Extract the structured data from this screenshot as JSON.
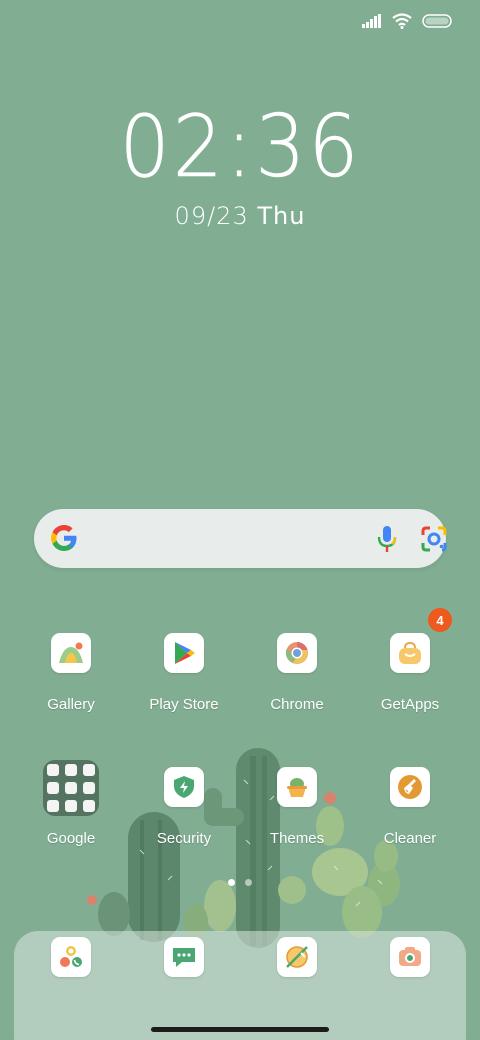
{
  "status_bar": {
    "signal_icon": "signal-icon",
    "wifi_icon": "wifi-icon",
    "battery_icon": "battery-icon"
  },
  "clock": {
    "time": "02:36",
    "date": "09/23",
    "weekday": "Thu"
  },
  "search": {
    "logo_icon": "google-logo-icon",
    "mic_icon": "microphone-icon",
    "lens_icon": "google-lens-icon"
  },
  "apps": [
    {
      "label": "Gallery",
      "icon": "gallery-icon"
    },
    {
      "label": "Play Store",
      "icon": "play-store-icon"
    },
    {
      "label": "Chrome",
      "icon": "chrome-icon"
    },
    {
      "label": "GetApps",
      "icon": "getapps-icon",
      "badge": "4"
    },
    {
      "label": "Google",
      "icon": "google-folder-icon"
    },
    {
      "label": "Security",
      "icon": "security-icon"
    },
    {
      "label": "Themes",
      "icon": "themes-icon"
    },
    {
      "label": "Cleaner",
      "icon": "cleaner-icon"
    }
  ],
  "dock": [
    {
      "icon": "phone-icon"
    },
    {
      "icon": "messaging-icon"
    },
    {
      "icon": "browser-icon"
    },
    {
      "icon": "camera-icon"
    }
  ],
  "pages": {
    "count": 2,
    "active": 1
  },
  "colors": {
    "wallpaper": "#81ae93",
    "badge": "#ee5a1e",
    "search_bar": "#e8edeb"
  }
}
